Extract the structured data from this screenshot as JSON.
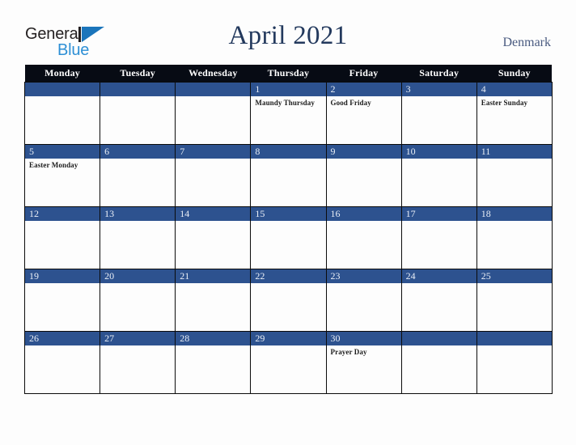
{
  "brand": {
    "name_part1": "General",
    "name_part2": "Blue"
  },
  "header": {
    "title": "April 2021",
    "country": "Denmark"
  },
  "calendar": {
    "weekday_headers": [
      "Monday",
      "Tuesday",
      "Wednesday",
      "Thursday",
      "Friday",
      "Saturday",
      "Sunday"
    ],
    "colors": {
      "header_bar": "#070b14",
      "day_band": "#2d528f",
      "title": "#23395d",
      "country": "#4a5b80",
      "brand_blue": "#2d8fd5",
      "page_background": "#fdfdfd"
    },
    "weeks": [
      [
        {
          "day": "",
          "event": ""
        },
        {
          "day": "",
          "event": ""
        },
        {
          "day": "",
          "event": ""
        },
        {
          "day": "1",
          "event": "Maundy Thursday"
        },
        {
          "day": "2",
          "event": "Good Friday"
        },
        {
          "day": "3",
          "event": ""
        },
        {
          "day": "4",
          "event": "Easter Sunday"
        }
      ],
      [
        {
          "day": "5",
          "event": "Easter Monday"
        },
        {
          "day": "6",
          "event": ""
        },
        {
          "day": "7",
          "event": ""
        },
        {
          "day": "8",
          "event": ""
        },
        {
          "day": "9",
          "event": ""
        },
        {
          "day": "10",
          "event": ""
        },
        {
          "day": "11",
          "event": ""
        }
      ],
      [
        {
          "day": "12",
          "event": ""
        },
        {
          "day": "13",
          "event": ""
        },
        {
          "day": "14",
          "event": ""
        },
        {
          "day": "15",
          "event": ""
        },
        {
          "day": "16",
          "event": ""
        },
        {
          "day": "17",
          "event": ""
        },
        {
          "day": "18",
          "event": ""
        }
      ],
      [
        {
          "day": "19",
          "event": ""
        },
        {
          "day": "20",
          "event": ""
        },
        {
          "day": "21",
          "event": ""
        },
        {
          "day": "22",
          "event": ""
        },
        {
          "day": "23",
          "event": ""
        },
        {
          "day": "24",
          "event": ""
        },
        {
          "day": "25",
          "event": ""
        }
      ],
      [
        {
          "day": "26",
          "event": ""
        },
        {
          "day": "27",
          "event": ""
        },
        {
          "day": "28",
          "event": ""
        },
        {
          "day": "29",
          "event": ""
        },
        {
          "day": "30",
          "event": "Prayer Day"
        },
        {
          "day": "",
          "event": ""
        },
        {
          "day": "",
          "event": ""
        }
      ]
    ]
  }
}
